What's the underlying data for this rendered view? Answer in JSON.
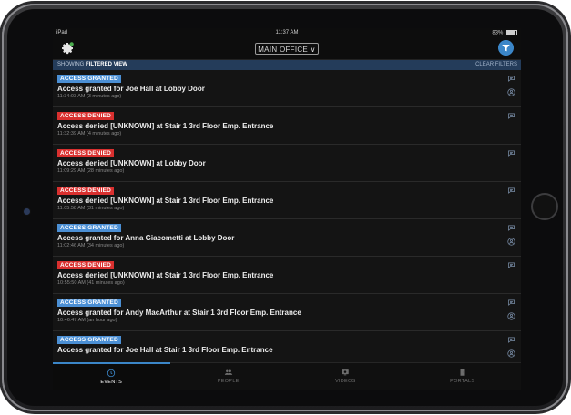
{
  "status_bar": {
    "device": "iPad",
    "time": "11:37 AM",
    "battery": "83%"
  },
  "nav": {
    "location": "MAIN OFFICE"
  },
  "filter_strip": {
    "prefix": "SHOWING",
    "view": "FILTERED VIEW",
    "clear_label": "CLEAR FILTERS"
  },
  "events": [
    {
      "badge": "ACCESS GRANTED",
      "status": "granted",
      "title": "Access granted for Joe Hall at Lobby Door",
      "time": "11:34:03 AM (3 minutes ago)",
      "has_person": true
    },
    {
      "badge": "ACCESS DENIED",
      "status": "denied",
      "title": "Access denied [UNKNOWN] at Stair 1 3rd Floor Emp. Entrance",
      "time": "11:32:39 AM (4 minutes ago)",
      "has_person": false
    },
    {
      "badge": "ACCESS DENIED",
      "status": "denied",
      "title": "Access denied [UNKNOWN] at Lobby Door",
      "time": "11:09:29 AM (28 minutes ago)",
      "has_person": false
    },
    {
      "badge": "ACCESS DENIED",
      "status": "denied",
      "title": "Access denied [UNKNOWN] at Stair 1 3rd Floor Emp. Entrance",
      "time": "11:05:58 AM (31 minutes ago)",
      "has_person": false
    },
    {
      "badge": "ACCESS GRANTED",
      "status": "granted",
      "title": "Access granted for Anna Giacometti at Lobby Door",
      "time": "11:02:46 AM (34 minutes ago)",
      "has_person": true
    },
    {
      "badge": "ACCESS DENIED",
      "status": "denied",
      "title": "Access denied [UNKNOWN] at Stair 1 3rd Floor Emp. Entrance",
      "time": "10:55:50 AM (41 minutes ago)",
      "has_person": false
    },
    {
      "badge": "ACCESS GRANTED",
      "status": "granted",
      "title": "Access granted for Andy MacArthur at Stair 1 3rd Floor Emp. Entrance",
      "time": "10:46:47 AM (an hour ago)",
      "has_person": true
    },
    {
      "badge": "ACCESS GRANTED",
      "status": "granted",
      "title": "Access granted for Joe Hall at Stair 1 3rd Floor Emp. Entrance",
      "time": "",
      "has_person": true
    }
  ],
  "tabs": [
    {
      "label": "EVENTS",
      "icon": "clock-icon",
      "active": true
    },
    {
      "label": "PEOPLE",
      "icon": "people-icon",
      "active": false
    },
    {
      "label": "VIDEOS",
      "icon": "video-icon",
      "active": false
    },
    {
      "label": "PORTALS",
      "icon": "door-icon",
      "active": false
    }
  ],
  "colors": {
    "granted": "#4b8fd4",
    "denied": "#d9302f",
    "accent": "#3b86c8",
    "filter_strip": "#243c5a"
  }
}
